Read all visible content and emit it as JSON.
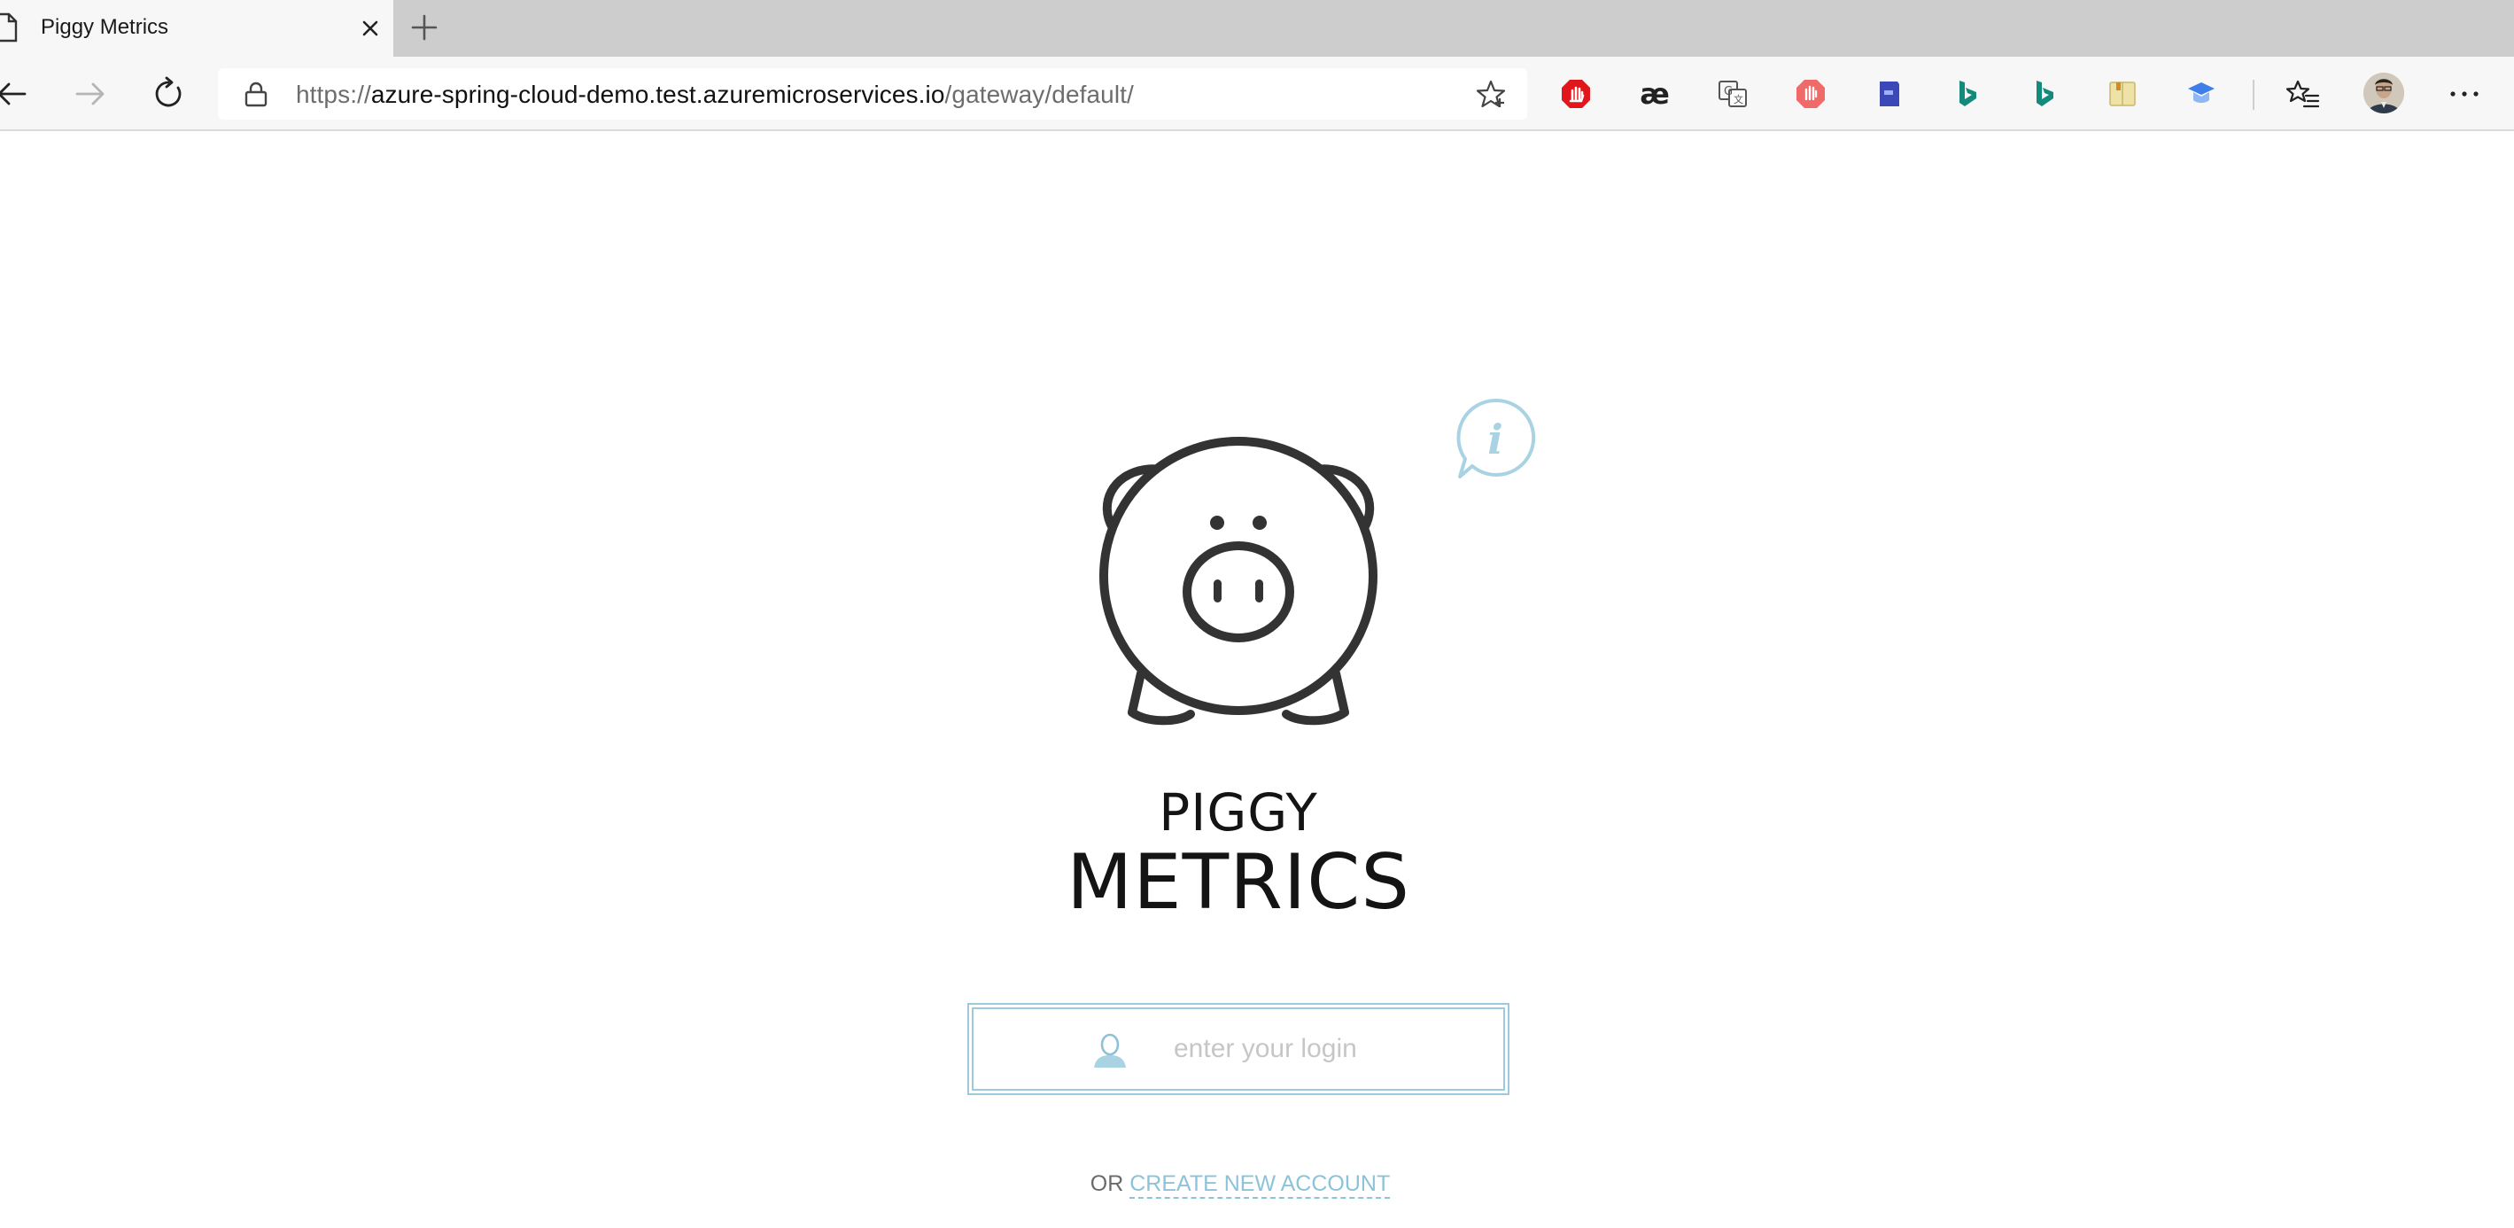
{
  "browser": {
    "tab": {
      "title": "Piggy Metrics"
    },
    "address_bar": {
      "scheme": "https://",
      "host": "azure-spring-cloud-demo.test.azuremicroservices.io",
      "path": "/gateway/default/"
    },
    "extensions": [
      "adblock-icon",
      "ae-ligature-icon",
      "translate-icon",
      "stop-hand-icon",
      "bookmark-book-icon",
      "bing-icon",
      "bing-icon",
      "reader-notes-icon",
      "shield-graduation-icon"
    ]
  },
  "page": {
    "brand_top": "PIGGY",
    "brand_bottom": "METRICS",
    "info_glyph": "i",
    "login": {
      "placeholder": "enter your login",
      "value": ""
    },
    "or_text": "OR",
    "create_account_label": "CREATE NEW ACCOUNT"
  },
  "colors": {
    "accent": "#9ccadc",
    "link": "#8dc3d8",
    "pig_stroke": "#333333",
    "tabstrip": "#cdcdcd",
    "toolbar": "#f7f7f7"
  }
}
